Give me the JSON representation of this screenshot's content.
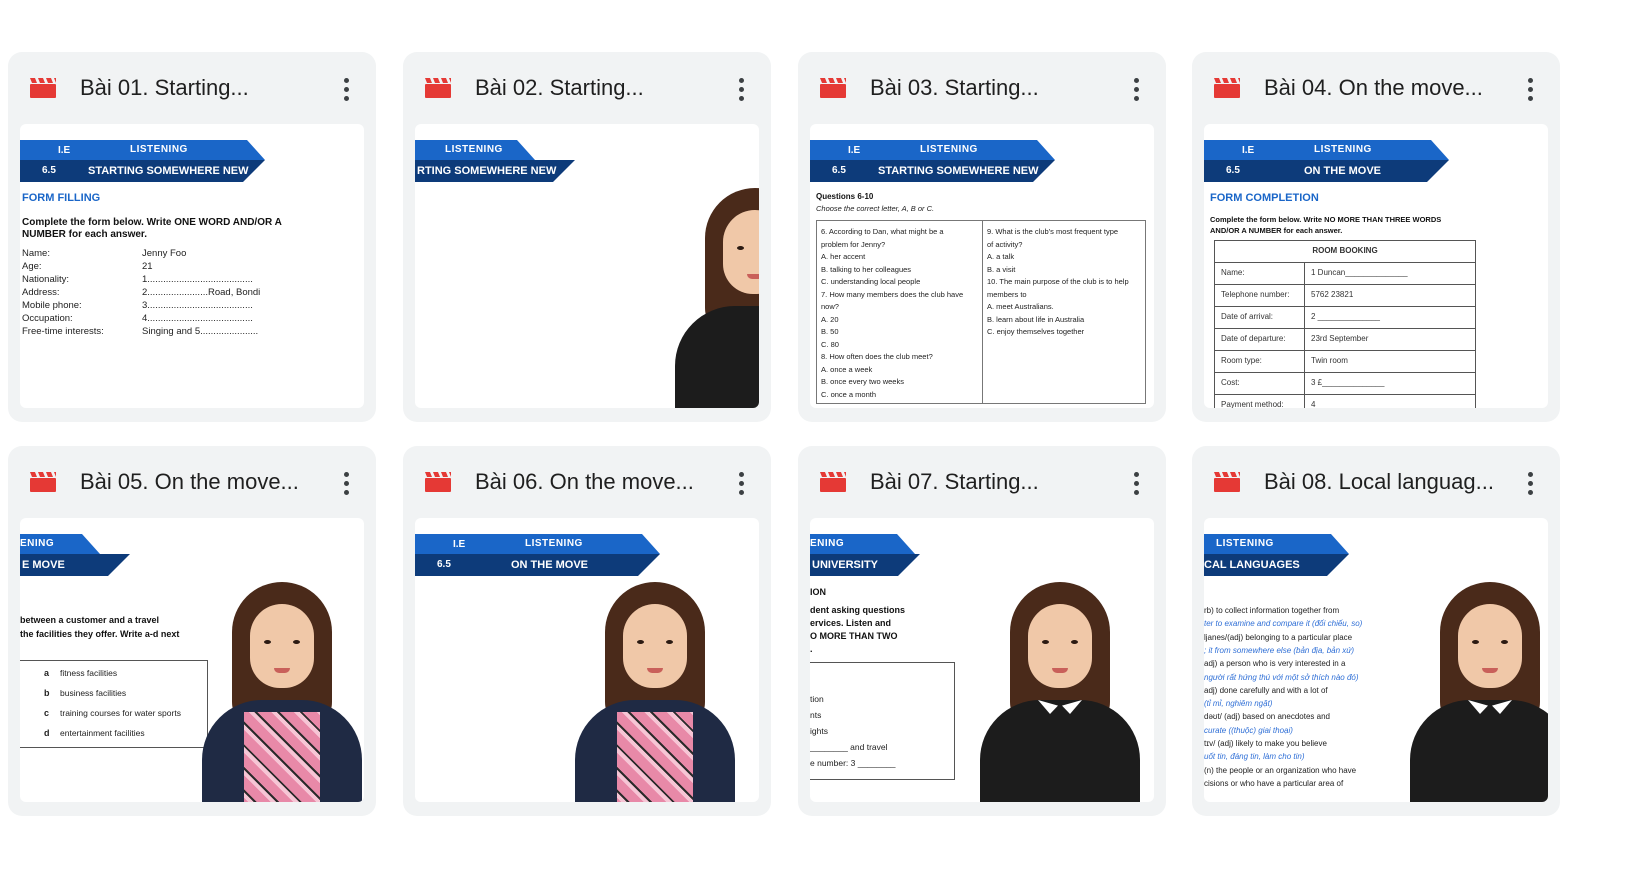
{
  "colors": {
    "card_bg": "#f1f3f4",
    "clap_red": "#e53935",
    "banner_light": "#1a66c8",
    "banner_dark": "#0d3b7a"
  },
  "videos": [
    {
      "title": "Bài 01. Starting...",
      "icon": "video-clapperboard-icon",
      "thumb": {
        "le": "I.E",
        "level": "6.5",
        "category": "LISTENING",
        "topic": "STARTING SOMEWHERE NEW",
        "section": "FORM FILLING",
        "instruction": [
          "Complete the form below. Write ONE WORD AND/OR A",
          "NUMBER for each answer."
        ],
        "form": [
          {
            "label": "Name:",
            "value": "Jenny Foo"
          },
          {
            "label": "Age:",
            "value": "21"
          },
          {
            "label": "Nationality:",
            "value": "1........................................"
          },
          {
            "label": "Address:",
            "value": "2.......................Road, Bondi"
          },
          {
            "label": "Mobile phone:",
            "value": "3........................................"
          },
          {
            "label": "Occupation:",
            "value": "4........................................"
          },
          {
            "label": "Free-time interests:",
            "value": "Singing and 5......................"
          }
        ]
      }
    },
    {
      "title": "Bài 02. Starting...",
      "icon": "video-clapperboard-icon",
      "thumb": {
        "category": "LISTENING",
        "topic": "RTING SOMEWHERE NEW"
      }
    },
    {
      "title": "Bài 03. Starting...",
      "icon": "video-clapperboard-icon",
      "thumb": {
        "le": "I.E",
        "level": "6.5",
        "category": "LISTENING",
        "topic": "STARTING SOMEWHERE NEW",
        "heading": "Questions 6-10",
        "sub": "Choose the correct letter, A, B or C.",
        "left_col": [
          "6. According to Dan, what might be a",
          "   problem for Jenny?",
          "   A. her accent",
          "   B. talking to her colleagues",
          "   C. understanding local people",
          "7. How many members does the club have",
          "   now?",
          "   A. 20",
          "   B. 50",
          "   C. 80",
          "8. How often does the club meet?",
          "   A. once a week",
          "   B. once every two weeks",
          "   C. once a month"
        ],
        "right_col": [
          "9. What is the club's most frequent type",
          "   of activity?",
          "   A. a talk",
          "   B. a visit",
          "10. The main purpose of the club is to help",
          "   members to",
          "   A. meet Australians.",
          "   B. learn about life in Australia",
          "   C. enjoy themselves together"
        ]
      }
    },
    {
      "title": "Bài 04. On the move...",
      "icon": "video-clapperboard-icon",
      "thumb": {
        "le": "I.E",
        "level": "6.5",
        "category": "LISTENING",
        "topic": "ON THE MOVE",
        "section": "FORM COMPLETION",
        "instruction": [
          "Complete the form below. Write NO MORE THAN THREE WORDS",
          "AND/OR A NUMBER for each answer."
        ],
        "table_title": "ROOM BOOKING",
        "rows": [
          {
            "label": "Name:",
            "value": "1  Duncan______________"
          },
          {
            "label": "Telephone number:",
            "value": "5762 23821"
          },
          {
            "label": "Date of arrival:",
            "value": "2  ______________"
          },
          {
            "label": "Date of departure:",
            "value": "23rd September"
          },
          {
            "label": "Room type:",
            "value": "Twin room"
          },
          {
            "label": "Cost:",
            "value": "3  £______________"
          },
          {
            "label": "Payment method:",
            "value": "4"
          }
        ]
      }
    },
    {
      "title": "Bài 05. On the move...",
      "icon": "video-clapperboard-icon",
      "thumb": {
        "category": "ENING",
        "topic": "E MOVE",
        "lines": [
          "between a customer and a travel",
          "the facilities they offer. Write a-d next"
        ],
        "options": [
          {
            "letter": "a",
            "text": "fitness facilities"
          },
          {
            "letter": "b",
            "text": "business facilities"
          },
          {
            "letter": "c",
            "text": "training courses for water sports"
          },
          {
            "letter": "d",
            "text": "entertainment facilities"
          }
        ]
      }
    },
    {
      "title": "Bài 06. On the move...",
      "icon": "video-clapperboard-icon",
      "thumb": {
        "le": "I.E",
        "level": "6.5",
        "category": "LISTENING",
        "topic": "ON THE MOVE"
      }
    },
    {
      "title": "Bài 07. Starting...",
      "icon": "video-clapperboard-icon",
      "thumb": {
        "category": "ENING",
        "topic": "UNIVERSITY",
        "section": "ION",
        "lines": [
          "dent asking questions",
          "ervices. Listen and",
          "O MORE THAN TWO",
          "."
        ],
        "box_lines": [
          "tion",
          "nts",
          "ights",
          "________ and travel",
          "e number: 3 ________"
        ]
      }
    },
    {
      "title": "Bài 08. Local languag...",
      "icon": "video-clapperboard-icon",
      "thumb": {
        "category": "LISTENING",
        "topic": "CAL LANGUAGES",
        "vocab": [
          {
            "text": "rb) to collect information together from",
            "blue": false
          },
          {
            "text": "ter to examine and compare it (đối chiếu, so)",
            "blue": true
          },
          {
            "text": "ljanes/(adj) belonging to a particular place",
            "blue": false
          },
          {
            "text": "; it from somewhere else (bản địa, bản xứ)",
            "blue": true
          },
          {
            "text": "adj) a person who is very interested in a",
            "blue": false
          },
          {
            "text": "người rất hứng thú với một sở thích nào đó)",
            "blue": true
          },
          {
            "text": "adj) done carefully and with a lot of",
            "blue": false
          },
          {
            "text": "(tỉ mỉ, nghiêm ngặt)",
            "blue": true
          },
          {
            "text": "dəʊt/ (adj) based on anecdotes and",
            "blue": false
          },
          {
            "text": "curate ((thuộc) giai thoại)",
            "blue": true
          },
          {
            "text": "tɪv/ (adj) likely to make you believe",
            "blue": false
          },
          {
            "text": "uốt tin, đáng tin, làm cho tin)",
            "blue": true
          },
          {
            "text": "(n) the people or an organization who have",
            "blue": false
          },
          {
            "text": "cisions or who have a particular area of",
            "blue": false
          }
        ]
      }
    }
  ]
}
